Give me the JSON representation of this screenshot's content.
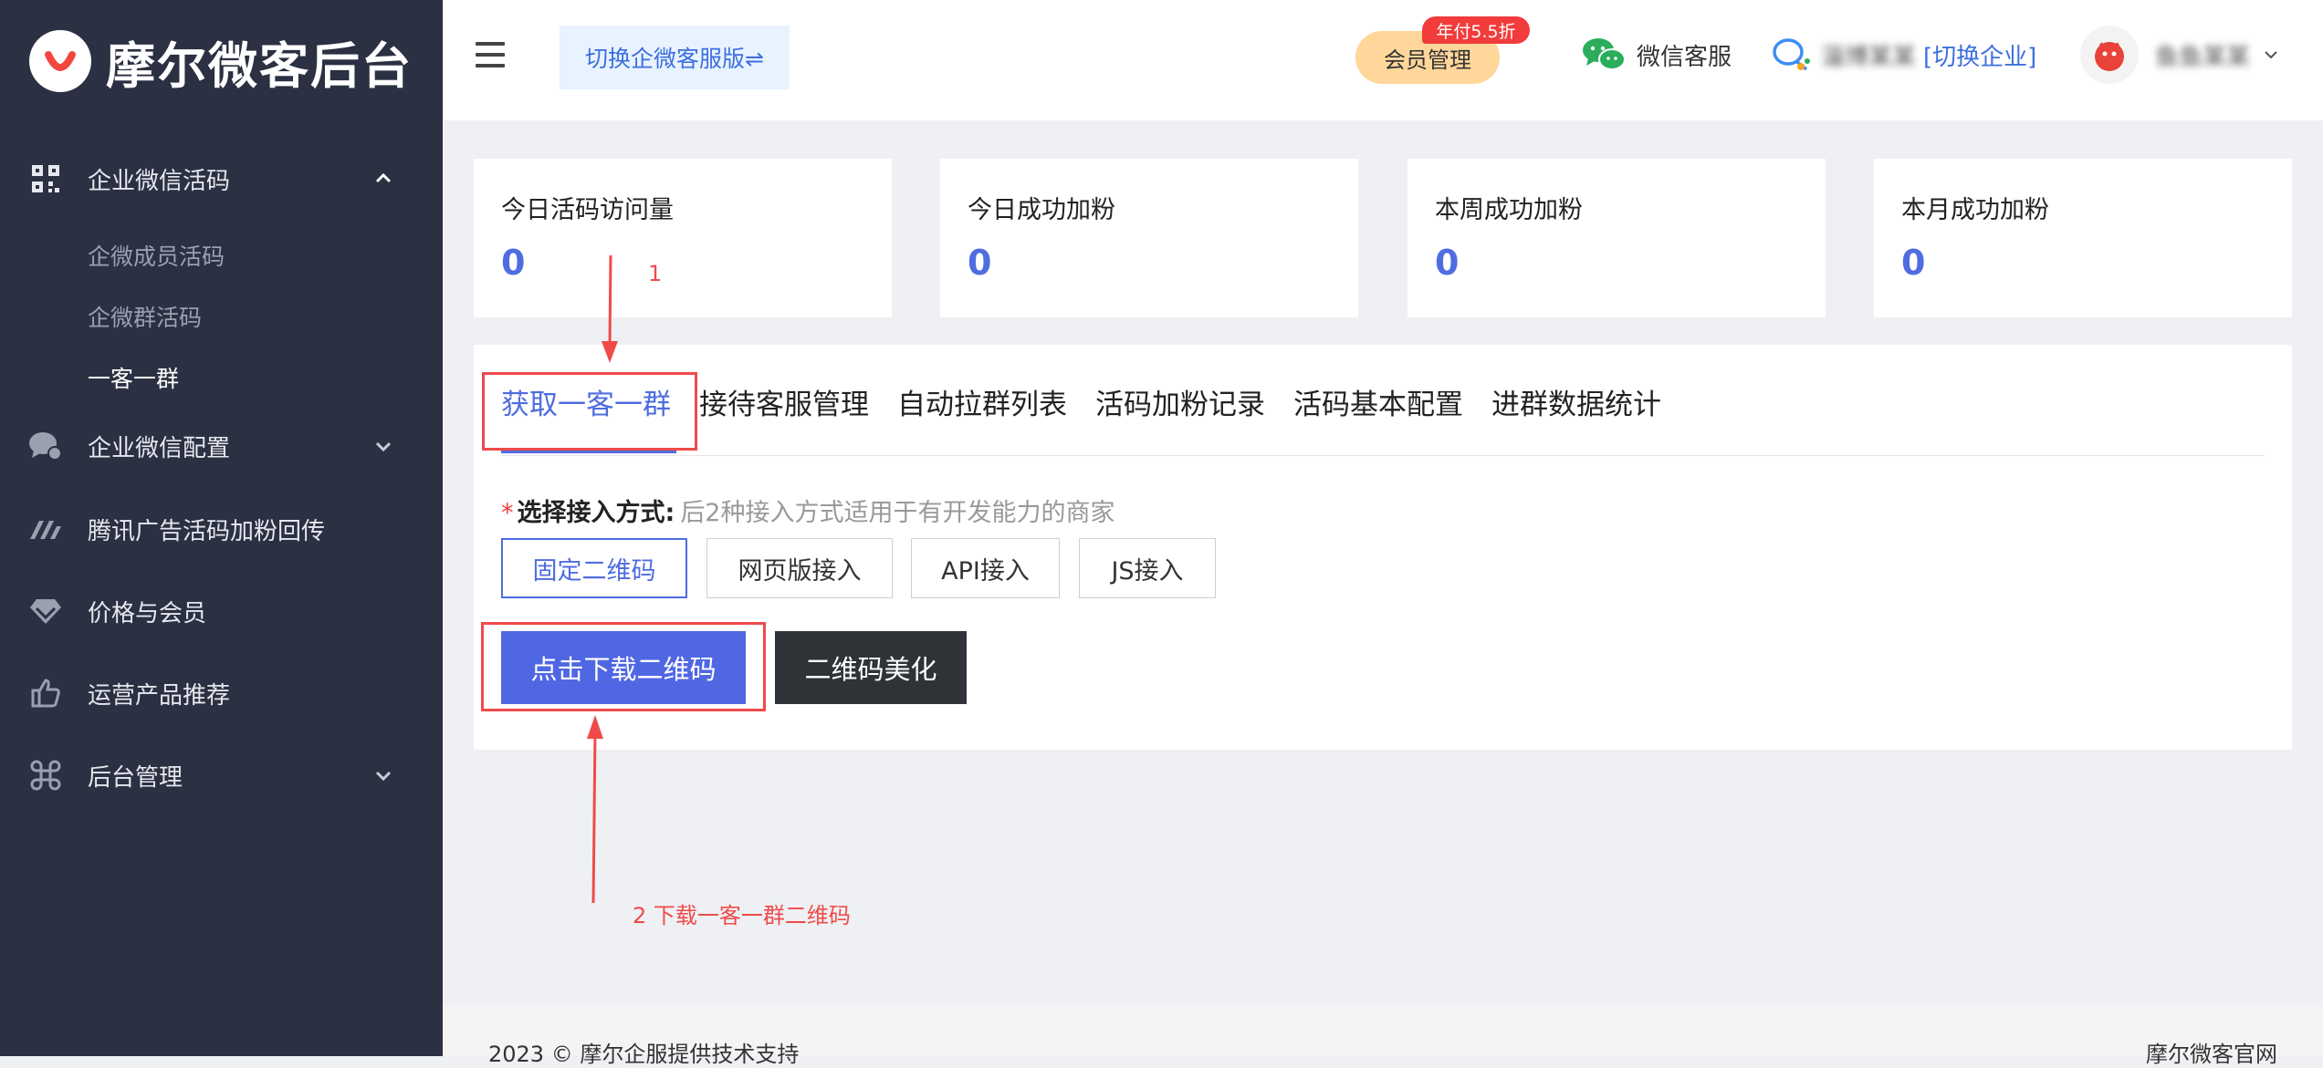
{
  "brand": {
    "title": "摩尔微客后台"
  },
  "sidebar": {
    "groups": [
      {
        "label": "企业微信活码",
        "icon": "qrcode-icon",
        "expanded": true
      },
      {
        "label": "企业微信配置",
        "icon": "chat-settings-icon",
        "expanded": false
      },
      {
        "label": "腾讯广告活码加粉回传",
        "icon": "tencent-ads-icon"
      },
      {
        "label": "价格与会员",
        "icon": "diamond-icon"
      },
      {
        "label": "运营产品推荐",
        "icon": "thumbs-up-icon"
      },
      {
        "label": "后台管理",
        "icon": "command-icon",
        "expanded": false
      }
    ],
    "sub_items": [
      "企微成员活码",
      "企微群活码",
      "一客一群"
    ],
    "active_sub": "一客一群"
  },
  "header": {
    "switch_label": "切换企微客服版⇌",
    "member_label": "会员管理",
    "discount_badge": "年付5.5折",
    "wechat_kf_label": "微信客服",
    "company_name": "淄博某某",
    "switch_company": "[切换企业]",
    "user_name": "鱼鱼某某"
  },
  "stats": [
    {
      "title": "今日活码访问量",
      "value": "0"
    },
    {
      "title": "今日成功加粉",
      "value": "0"
    },
    {
      "title": "本周成功加粉",
      "value": "0"
    },
    {
      "title": "本月成功加粉",
      "value": "0"
    }
  ],
  "tabs": [
    "获取一客一群",
    "接待客服管理",
    "自动拉群列表",
    "活码加粉记录",
    "活码基本配置",
    "进群数据统计"
  ],
  "active_tab": "获取一客一群",
  "access": {
    "required_mark": "*",
    "label": "选择接入方式:",
    "hint": "后2种接入方式适用于有开发能力的商家",
    "options": [
      "固定二维码",
      "网页版接入",
      "API接入",
      "JS接入"
    ],
    "selected": "固定二维码"
  },
  "actions": {
    "download": "点击下载二维码",
    "beautify": "二维码美化"
  },
  "annotations": {
    "step1": "1",
    "step2": "2 下载一客一群二维码"
  },
  "footer": {
    "left": "2023 © 摩尔企服提供技术支持",
    "right": "摩尔微客官网"
  },
  "colors": {
    "accent": "#4f6ce0",
    "sidebar_bg": "#2b3042",
    "annotation": "#f04a4a",
    "badge": "#f23b3b"
  }
}
